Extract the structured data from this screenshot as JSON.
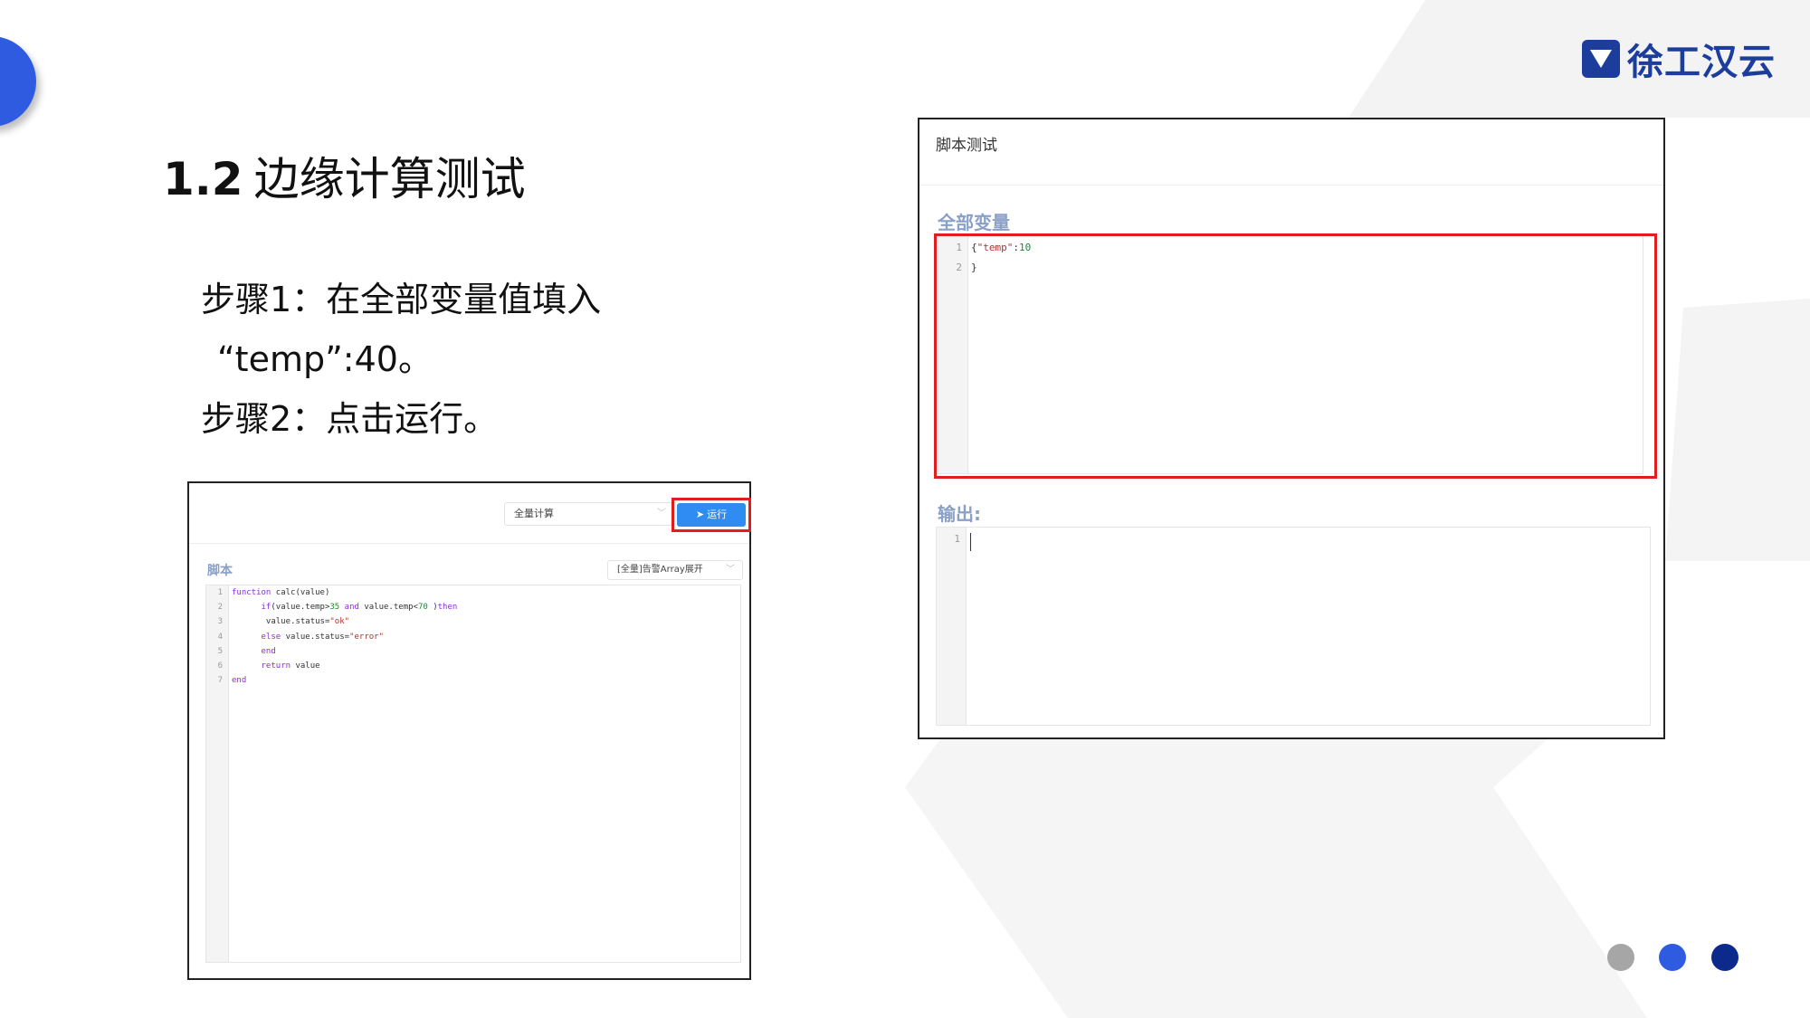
{
  "logo": {
    "text": "徐工汉云"
  },
  "slide": {
    "title_number": "1.2",
    "title_text": "边缘计算测试",
    "steps": [
      "步骤1：在全部变量值填入",
      "“temp”:40。",
      "步骤2：点击运行。"
    ]
  },
  "script_panel": {
    "compute_select": "全量计算",
    "run_button": "运行",
    "script_label": "脚本",
    "mode_select": "[全量]告警Array展开",
    "code_lines": [
      "function calc(value)",
      "      if(value.temp>35 and value.temp<70 )then",
      "       value.status=\"ok\"",
      "      else value.status=\"error\"",
      "      end",
      "      return value",
      "end"
    ],
    "line_numbers": [
      "1",
      "2",
      "3",
      "4",
      "5",
      "6",
      "7"
    ]
  },
  "test_panel": {
    "title": "脚本测试",
    "vars_label": "全部变量",
    "vars_lines": [
      "{\"temp\":10",
      "}"
    ],
    "vars_line_numbers": [
      "1",
      "2"
    ],
    "output_label": "输出:",
    "output_line_numbers": [
      "1"
    ]
  },
  "colors": {
    "accent_blue": "#2f5be0",
    "navy": "#1c3d9c",
    "highlight_red": "#e01e1e",
    "run_button": "#2f8cf2",
    "dot_gray": "#a6a6a6",
    "dot_blue": "#2f5be0",
    "dot_navy": "#0b2a8c"
  }
}
